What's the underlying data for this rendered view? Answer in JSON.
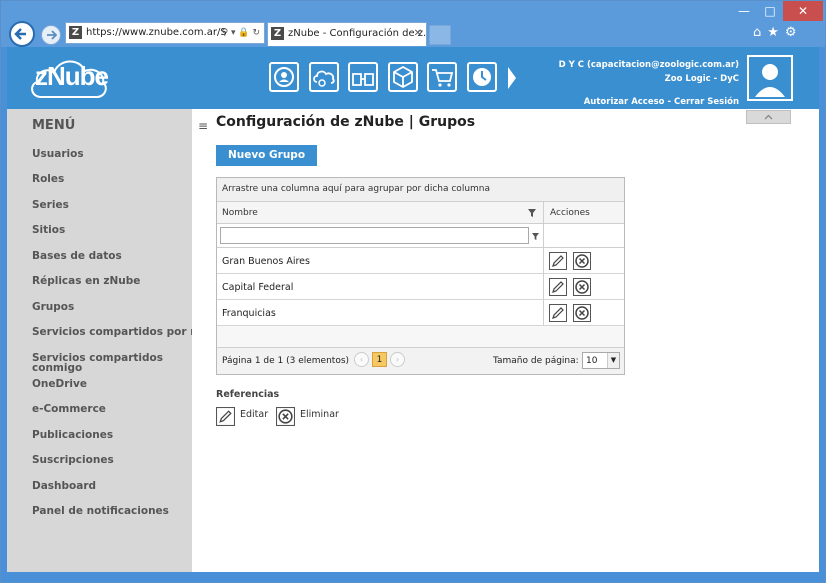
{
  "browser": {
    "url": "https://www.znube.com.ar/S",
    "tab_title": "zNube - Configuración de z..."
  },
  "header": {
    "logo": "zNube",
    "user_line": "D Y C (capacitacion@zoologic.com.ar)",
    "company": "Zoo Logic - DyC",
    "authorize": "Autorizar Acceso",
    "separator": " - ",
    "logout": "Cerrar Sesión",
    "icons": [
      "user-cycle-icon",
      "cloud-gear-icon",
      "shops-icon",
      "box-icon",
      "cart-icon",
      "clock-icon"
    ]
  },
  "sidebar": {
    "title": "MENÚ",
    "items": [
      {
        "label": "Usuarios"
      },
      {
        "label": "Roles"
      },
      {
        "label": "Series"
      },
      {
        "label": "Sitios"
      },
      {
        "label": "Bases de datos"
      },
      {
        "label": "Réplicas en zNube"
      },
      {
        "label": "Grupos"
      },
      {
        "label": "Servicios compartidos por mi"
      },
      {
        "label": "Servicios compartidos conmigo"
      },
      {
        "label": "OneDrive"
      },
      {
        "label": "e-Commerce"
      },
      {
        "label": "Publicaciones"
      },
      {
        "label": "Suscripciones"
      },
      {
        "label": "Dashboard"
      },
      {
        "label": "Panel de notificaciones"
      }
    ]
  },
  "main": {
    "title": "Configuración de zNube | Grupos",
    "new_button": "Nuevo Grupo",
    "grid": {
      "group_hint": "Arrastre una columna aquí para agrupar por dicha columna",
      "col_name": "Nombre",
      "col_actions": "Acciones",
      "filter_value": "",
      "rows": [
        {
          "name": "Gran Buenos Aires"
        },
        {
          "name": "Capital Federal"
        },
        {
          "name": "Franquicias"
        }
      ],
      "pager_text": "Página 1 de 1 (3 elementos)",
      "current_page": "1",
      "page_size_label": "Tamaño de página:",
      "page_size": "10"
    },
    "refs": {
      "title": "Referencias",
      "edit": "Editar",
      "delete": "Eliminar"
    }
  }
}
